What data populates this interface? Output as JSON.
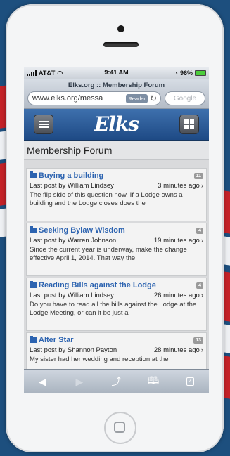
{
  "status_bar": {
    "carrier": "AT&T",
    "time": "9:41 AM",
    "battery": "96%"
  },
  "browser": {
    "page_title": "Elks.org :: Membership Forum",
    "url": "www.elks.org/messa",
    "reader_label": "Reader",
    "search_placeholder": "Google"
  },
  "site": {
    "logo": "Elks",
    "heading": "Membership Forum"
  },
  "posts": [
    {
      "title": "Buying a building",
      "count": "11",
      "last_post": "Last post by William Lindsey",
      "ago": "3 minutes ago",
      "excerpt": "The flip side of this question now. If a Lodge owns a building and the Lodge closes does the"
    },
    {
      "title": "Seeking Bylaw Wisdom",
      "count": "4",
      "last_post": "Last post by Warren Johnson",
      "ago": "19 minutes ago",
      "excerpt": "Since the current year is underway, make the change effective April 1, 2014. That way the"
    },
    {
      "title": "Reading Bills against the Lodge",
      "count": "4",
      "last_post": "Last post by William Lindsey",
      "ago": "26 minutes ago",
      "excerpt": "Do you have to read all the bills against the Lodge at the Lodge Meeting, or can it be just a"
    },
    {
      "title": "Alter Star",
      "count": "13",
      "last_post": "Last post by Shannon Payton",
      "ago": "28 minutes ago",
      "excerpt": "My sister had her wedding and reception at the"
    }
  ],
  "toolbar": {
    "back": "◀",
    "forward": "▶",
    "tabs_count": "4"
  },
  "colors": {
    "accent": "#2c63b0",
    "header": "#2a5b9a"
  }
}
